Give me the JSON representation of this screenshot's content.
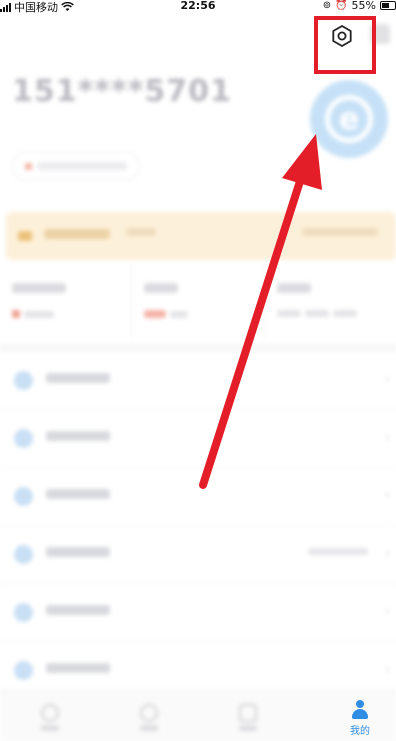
{
  "status_bar": {
    "carrier": "中国移动",
    "time": "22:56",
    "battery": "55%"
  },
  "profile": {
    "phone": "151****5701"
  },
  "tabbar": {
    "active_label": "我的"
  },
  "icons": {
    "settings": "settings-gear-icon",
    "wifi": "wifi-icon",
    "signal": "signal-icon",
    "battery": "battery-icon",
    "alarm": "alarm-icon",
    "lock_rotation": "rotation-lock-icon"
  },
  "colors": {
    "annotation_red": "#e41e28",
    "accent_blue": "#2f8de4"
  }
}
